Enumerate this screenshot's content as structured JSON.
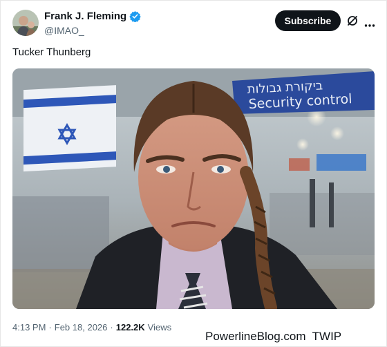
{
  "author": {
    "name": "Frank J. Fleming",
    "handle": "@IMAO_",
    "verified": true
  },
  "header": {
    "subscribe_label": "Subscribe",
    "grok_icon": "grok-icon",
    "more_icon": "more-options-icon"
  },
  "tweet": {
    "text": "Tucker Thunberg"
  },
  "media": {
    "sign_text": "Security control",
    "sign_hebrew": "ביקורת גבולות"
  },
  "meta": {
    "time": "4:13 PM",
    "date": "Feb 18, 2026",
    "views_count": "122.2K",
    "views_label": "Views",
    "separator": "·"
  },
  "watermark": "PowerlineBlog.com  TWIP",
  "colors": {
    "accent": "#1d9bf0",
    "text_primary": "#0f1419",
    "text_secondary": "#536471",
    "button_bg": "#0f1419"
  }
}
